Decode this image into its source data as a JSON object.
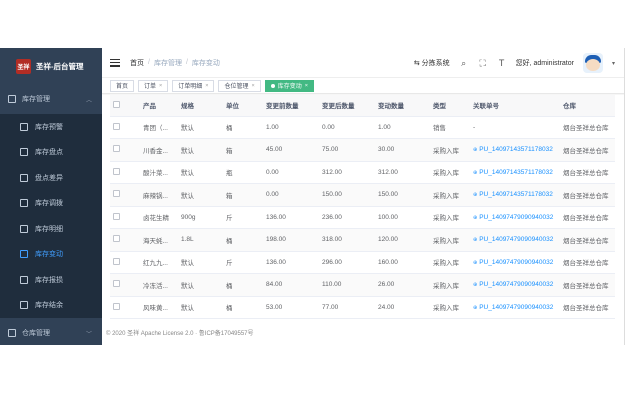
{
  "brand": {
    "logo_text": "圣祥",
    "title": "圣祥-后台管理"
  },
  "sidebar": {
    "group": {
      "label": "库存管理",
      "icon": "box-icon"
    },
    "items": [
      {
        "label": "库存预警",
        "icon": "warning-icon",
        "active": false
      },
      {
        "label": "库存盘点",
        "icon": "clipboard-icon",
        "active": false
      },
      {
        "label": "盘点差异",
        "icon": "diff-icon",
        "active": false
      },
      {
        "label": "库存调拨",
        "icon": "transfer-icon",
        "active": false
      },
      {
        "label": "库存明细",
        "icon": "list-icon",
        "active": false
      },
      {
        "label": "库存变动",
        "icon": "change-icon",
        "active": true
      },
      {
        "label": "库存报损",
        "icon": "loss-icon",
        "active": false
      },
      {
        "label": "库存结余",
        "icon": "balance-icon",
        "active": false
      }
    ],
    "bottom": {
      "label": "仓库管理",
      "icon": "warehouse-icon"
    }
  },
  "navbar": {
    "breadcrumb": [
      "首页",
      "库存管理",
      "库存变动"
    ],
    "tenant_system": "分拣系统",
    "greeting": "您好, administrator"
  },
  "tags": [
    {
      "label": "首页",
      "closable": false,
      "active": false
    },
    {
      "label": "订单",
      "closable": true,
      "active": false
    },
    {
      "label": "订单明细",
      "closable": true,
      "active": false
    },
    {
      "label": "仓位管理",
      "closable": true,
      "active": false
    },
    {
      "label": "库存变动",
      "closable": true,
      "active": true
    }
  ],
  "table": {
    "columns": [
      "产品",
      "规格",
      "单位",
      "变更前数量",
      "变更后数量",
      "变动数量",
      "类型",
      "关联单号",
      "仓库"
    ],
    "rows": [
      {
        "product": "青团（...",
        "spec": "默认",
        "unit": "桶",
        "before": "1.00",
        "after": "0.00",
        "change": "1.00",
        "type": "销售",
        "order": "-",
        "has_link": false,
        "warehouse": "烟台圣祥总仓库"
      },
      {
        "product": "川香金...",
        "spec": "默认",
        "unit": "箱",
        "before": "45.00",
        "after": "75.00",
        "change": "30.00",
        "type": "采购入库",
        "order": "PU_14097143571178032",
        "has_link": true,
        "warehouse": "烟台圣祥总仓库"
      },
      {
        "product": "酸汁菜...",
        "spec": "默认",
        "unit": "瓶",
        "before": "0.00",
        "after": "312.00",
        "change": "312.00",
        "type": "采购入库",
        "order": "PU_14097143571178032",
        "has_link": true,
        "warehouse": "烟台圣祥总仓库"
      },
      {
        "product": "麻辣锅...",
        "spec": "默认",
        "unit": "箱",
        "before": "0.00",
        "after": "150.00",
        "change": "150.00",
        "type": "采购入库",
        "order": "PU_14097143571178032",
        "has_link": true,
        "warehouse": "烟台圣祥总仓库"
      },
      {
        "product": "卤花生精",
        "spec": "900g",
        "unit": "斤",
        "before": "136.00",
        "after": "236.00",
        "change": "100.00",
        "type": "采购入库",
        "order": "PU_14097479090940032",
        "has_link": true,
        "warehouse": "烟台圣祥总仓库"
      },
      {
        "product": "海天蚝...",
        "spec": "1.8L",
        "unit": "桶",
        "before": "198.00",
        "after": "318.00",
        "change": "120.00",
        "type": "采购入库",
        "order": "PU_14097479090940032",
        "has_link": true,
        "warehouse": "烟台圣祥总仓库"
      },
      {
        "product": "红九九...",
        "spec": "默认",
        "unit": "斤",
        "before": "136.00",
        "after": "296.00",
        "change": "160.00",
        "type": "采购入库",
        "order": "PU_14097479090940032",
        "has_link": true,
        "warehouse": "烟台圣祥总仓库"
      },
      {
        "product": "冷冻活...",
        "spec": "默认",
        "unit": "桶",
        "before": "84.00",
        "after": "110.00",
        "change": "26.00",
        "type": "采购入库",
        "order": "PU_14097479090940032",
        "has_link": true,
        "warehouse": "烟台圣祥总仓库"
      },
      {
        "product": "风味黄...",
        "spec": "默认",
        "unit": "桶",
        "before": "53.00",
        "after": "77.00",
        "change": "24.00",
        "type": "采购入库",
        "order": "PU_14097479090940032",
        "has_link": true,
        "warehouse": "烟台圣祥总仓库"
      }
    ]
  },
  "footer": {
    "text": "© 2020 圣祥 Apache License 2.0 · 鲁ICP备17049557号"
  }
}
